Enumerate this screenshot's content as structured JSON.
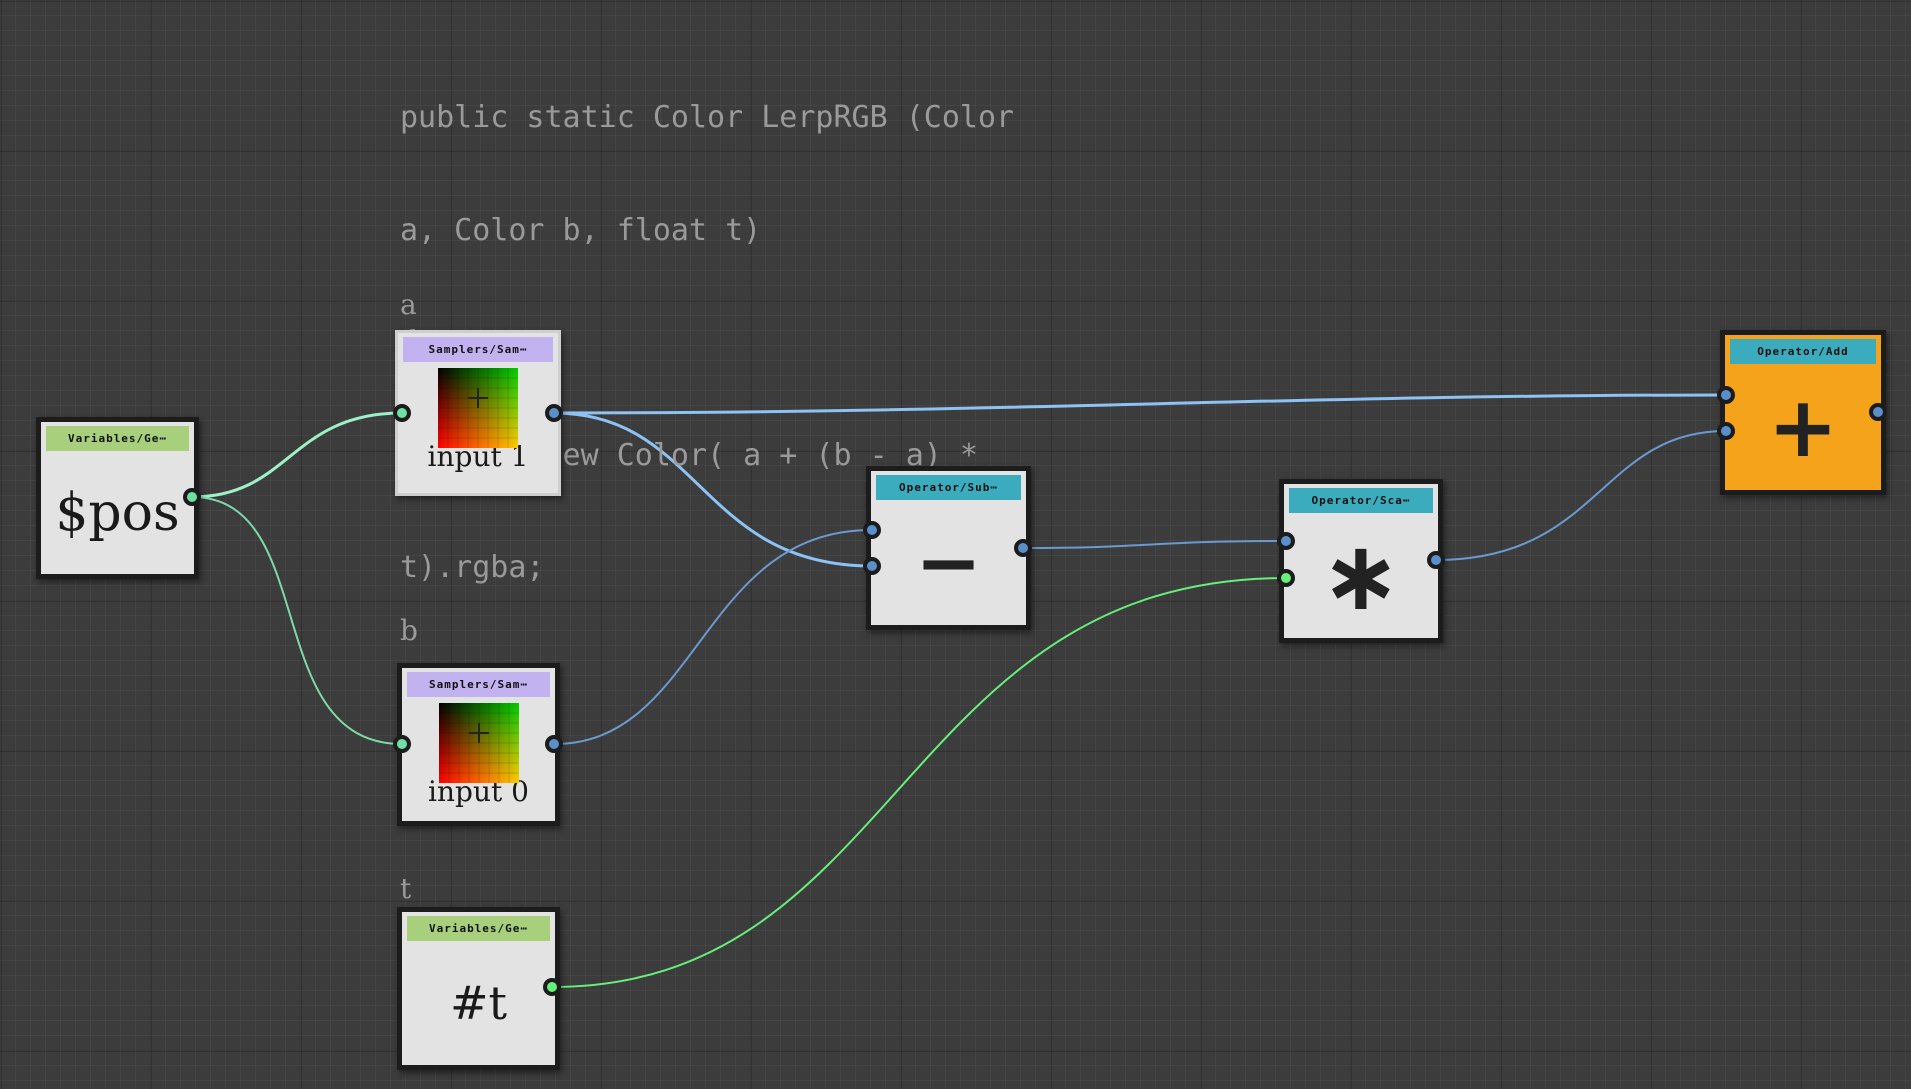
{
  "comment": {
    "lines": [
      "public static Color LerpRGB (Color",
      "a, Color b, float t)",
      "{",
      " return new Color( a + (b - a) *",
      "t).rgba;",
      "}"
    ]
  },
  "labels": {
    "a": "a",
    "b": "b",
    "t": "t"
  },
  "nodes": {
    "pos": {
      "header": "Variables/Ge⋯",
      "text": "$pos"
    },
    "sampler_a": {
      "header": "Samplers/Sam⋯",
      "text": "input 1"
    },
    "sampler_b": {
      "header": "Samplers/Sam⋯",
      "text": "input 0"
    },
    "t_var": {
      "header": "Variables/Ge⋯",
      "text": "#t"
    },
    "subtract": {
      "header": "Operator/Sub⋯",
      "symbol": "−"
    },
    "scale": {
      "header": "Operator/Sca⋯",
      "symbol": "∗"
    },
    "add": {
      "header": "Operator/Add",
      "symbol": "+"
    }
  },
  "colors": {
    "background": "#3c3c3c",
    "node_body": "#e3e3e3",
    "header_variables": "#a7cf7c",
    "header_samplers": "#c3b2f0",
    "header_operator": "#3aacbd",
    "add_node_body": "#f5a31a",
    "wire_position": "#9ef0c6",
    "wire_color": "#8dc2f5",
    "wire_color_thin": "#6a9ad0",
    "wire_float": "#66f07a"
  }
}
